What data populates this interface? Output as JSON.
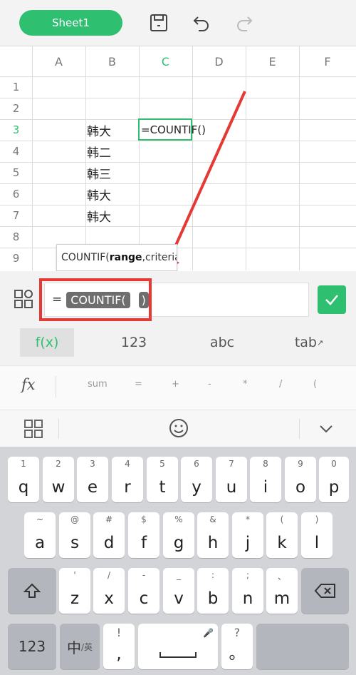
{
  "toolbar": {
    "sheet_tab": "Sheet1"
  },
  "grid": {
    "columns": [
      "A",
      "B",
      "C",
      "D",
      "E",
      "F"
    ],
    "active_column": "C",
    "rows": [
      "1",
      "2",
      "3",
      "4",
      "5",
      "6",
      "7",
      "8",
      "9"
    ],
    "active_row": "3",
    "cells": {
      "B3": "韩大",
      "B4": "韩二",
      "B5": "韩三",
      "B6": "韩大",
      "B7": "韩大",
      "C3": "=COUNTIF()"
    }
  },
  "tooltip": {
    "fn": "COUNTIF(",
    "arg1": "range",
    "rest": ",criteria)"
  },
  "formula": {
    "prefix": "=",
    "token": "COUNTIF(",
    "close": ")"
  },
  "mode_tabs": [
    "f(x)",
    "123",
    "abc",
    "tab"
  ],
  "fx_bar": {
    "label": "fx",
    "items": [
      "sum",
      "=",
      "+",
      "-",
      "*",
      "/",
      "("
    ]
  },
  "keyboard": {
    "row1": [
      {
        "hint": "1",
        "key": "q"
      },
      {
        "hint": "2",
        "key": "w"
      },
      {
        "hint": "3",
        "key": "e"
      },
      {
        "hint": "4",
        "key": "r"
      },
      {
        "hint": "5",
        "key": "t"
      },
      {
        "hint": "6",
        "key": "y"
      },
      {
        "hint": "7",
        "key": "u"
      },
      {
        "hint": "8",
        "key": "i"
      },
      {
        "hint": "9",
        "key": "o"
      },
      {
        "hint": "0",
        "key": "p"
      }
    ],
    "row2": [
      {
        "hint": "~",
        "key": "a"
      },
      {
        "hint": "@",
        "key": "s"
      },
      {
        "hint": "#",
        "key": "d"
      },
      {
        "hint": "$",
        "key": "f"
      },
      {
        "hint": "%",
        "key": "g"
      },
      {
        "hint": "&",
        "key": "h"
      },
      {
        "hint": "*",
        "key": "j"
      },
      {
        "hint": "(",
        "key": "k"
      },
      {
        "hint": ")",
        "key": "l"
      }
    ],
    "row3": [
      {
        "hint": "'",
        "key": "z"
      },
      {
        "hint": "/",
        "key": "x"
      },
      {
        "hint": "-",
        "key": "c"
      },
      {
        "hint": "_",
        "key": "v"
      },
      {
        "hint": ":",
        "key": "b"
      },
      {
        "hint": ";",
        "key": "n"
      },
      {
        "hint": "、",
        "key": "m"
      }
    ],
    "bottom": {
      "num": "123",
      "lang_main": "中",
      "lang_sub": "/英",
      "punct_top": "!",
      "punct_bottom": ",",
      "q_top": "?",
      "q_bottom": "。"
    }
  },
  "colors": {
    "accent": "#2fbf71",
    "highlight": "#e53935"
  }
}
